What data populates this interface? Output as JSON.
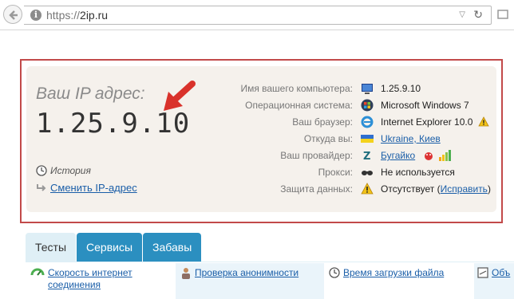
{
  "browser": {
    "url_scheme": "https://",
    "url_host": "2ip.ru"
  },
  "ip": {
    "label": "Ваш IP адрес:",
    "value": "1.25.9.10",
    "history_label": "История",
    "change_label": "Сменить IP-адрес"
  },
  "info_rows": [
    {
      "label": "Имя вашего компьютера:",
      "value": "1.25.9.10",
      "icon": "computer-icon"
    },
    {
      "label": "Операционная система:",
      "value": "Microsoft Windows 7",
      "icon": "windows-icon"
    },
    {
      "label": "Ваш браузер:",
      "value": "Internet Explorer 10.0",
      "icon": "ie-icon"
    },
    {
      "label": "Откуда вы:",
      "value": "Ukraine, Киев",
      "icon": "flag-icon"
    },
    {
      "label": "Ваш провайдер:",
      "value": "Бугайко",
      "icon": "provider-icon"
    },
    {
      "label": "Прокси:",
      "value": "Не используется",
      "icon": "glasses-icon"
    },
    {
      "label": "Защита данных:",
      "value_prefix": "Отсутствует (",
      "value_link": "Исправить",
      "value_suffix": ")",
      "icon": "warning-icon"
    }
  ],
  "tabs": [
    "Тесты",
    "Сервисы",
    "Забавы"
  ],
  "services": [
    {
      "label": "Скорость интернет соединения",
      "icon": "speed-icon"
    },
    {
      "label": "Проверка анонимности",
      "icon": "person-icon"
    },
    {
      "label": "Время загрузки файла",
      "icon": "clock-icon"
    },
    {
      "label": "Объ",
      "icon": "file-icon"
    }
  ]
}
